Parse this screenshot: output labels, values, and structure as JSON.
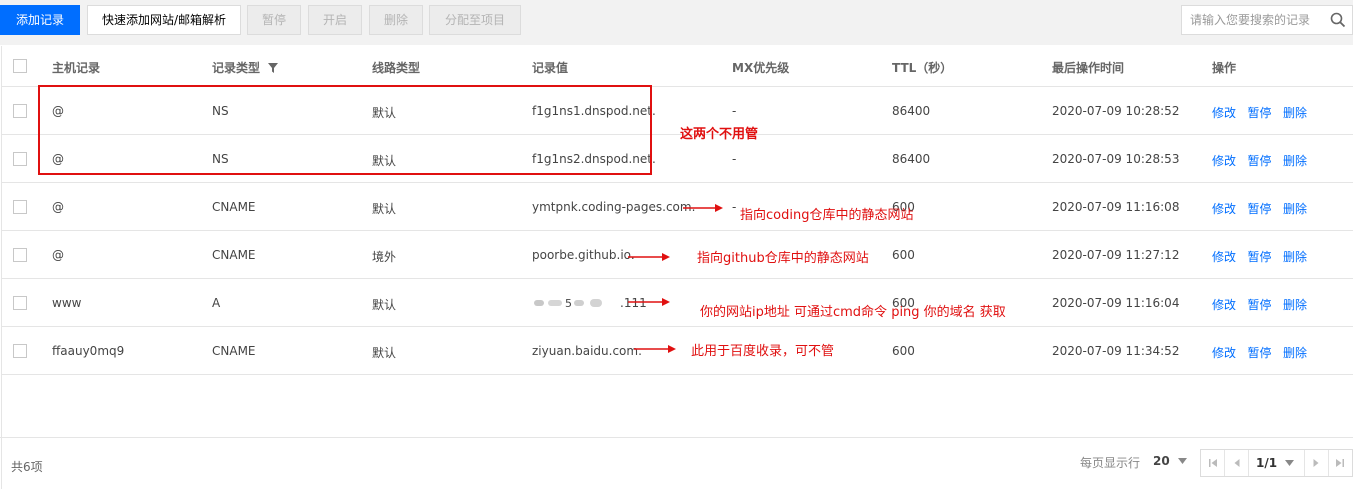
{
  "toolbar": {
    "add_record": "添加记录",
    "quick_add": "快速添加网站/邮箱解析",
    "pause": "暂停",
    "enable": "开启",
    "delete": "删除",
    "assign_project": "分配至项目",
    "search_placeholder": "请输入您要搜索的记录",
    "search_icon": "search-icon"
  },
  "table": {
    "columns": [
      "主机记录",
      "记录类型",
      "线路类型",
      "记录值",
      "MX优先级",
      "TTL（秒）",
      "最后操作时间",
      "操作"
    ],
    "filter_icon": "filter-icon",
    "rows": [
      {
        "host": "@",
        "type": "NS",
        "line": "默认",
        "value": "f1g1ns1.dnspod.net.",
        "mx": "-",
        "ttl": "86400",
        "time": "2020-07-09 10:28:52"
      },
      {
        "host": "@",
        "type": "NS",
        "line": "默认",
        "value": "f1g1ns2.dnspod.net.",
        "mx": "-",
        "ttl": "86400",
        "time": "2020-07-09 10:28:53"
      },
      {
        "host": "@",
        "type": "CNAME",
        "line": "默认",
        "value": "ymtpnk.coding-pages.com.",
        "mx": "-",
        "ttl": "600",
        "time": "2020-07-09 11:16:08"
      },
      {
        "host": "@",
        "type": "CNAME",
        "line": "境外",
        "value": "poorbe.github.io.",
        "mx": "",
        "ttl": "600",
        "time": "2020-07-09 11:27:12"
      },
      {
        "host": "www",
        "type": "A",
        "line": "默认",
        "value": ".111",
        "mx": "",
        "ttl": "600",
        "time": "2020-07-09 11:16:04"
      },
      {
        "host": "ffaauy0mq9",
        "type": "CNAME",
        "line": "默认",
        "value": "ziyuan.baidu.com.",
        "mx": "",
        "ttl": "600",
        "time": "2020-07-09 11:34:52"
      }
    ],
    "actions": {
      "edit": "修改",
      "pause": "暂停",
      "delete": "删除"
    }
  },
  "annotations": {
    "ns": "这两个不用管",
    "coding": "指向coding仓库中的静态网站",
    "github": "指向github仓库中的静态网站",
    "ip": "你的网站ip地址 可通过cmd命令 ping 你的域名  获取",
    "baidu": "此用于百度收录，可不管",
    "color": "#e01010"
  },
  "footer": {
    "total": "共6项",
    "per_page_label": "每页显示行",
    "per_page_value": "20",
    "page": "1/1"
  },
  "colors": {
    "primary": "#006eff",
    "annotation": "#e01010"
  }
}
